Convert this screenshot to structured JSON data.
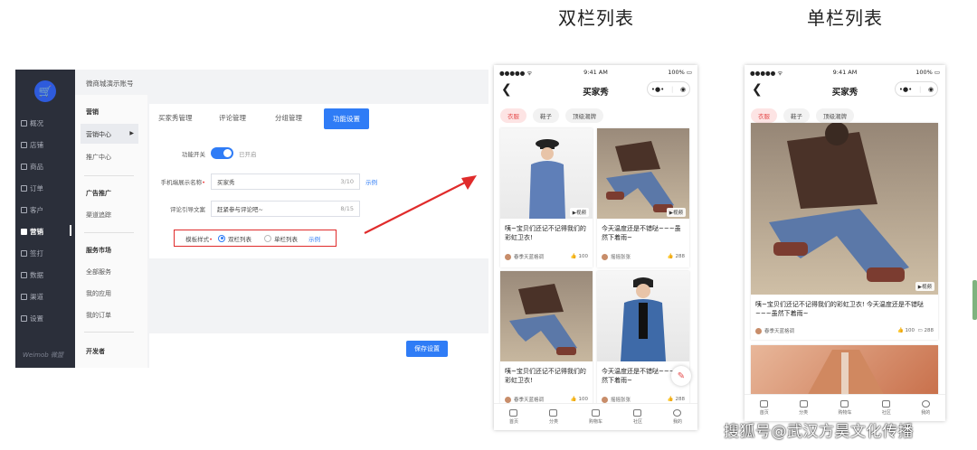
{
  "headings": {
    "double": "双栏列表",
    "single": "单栏列表"
  },
  "admin": {
    "account": "微商城演示账号",
    "brand": "Weimob 微盟",
    "nav": [
      {
        "label": "概况",
        "icon": "overview-icon"
      },
      {
        "label": "店铺",
        "icon": "store-icon"
      },
      {
        "label": "商品",
        "icon": "goods-icon"
      },
      {
        "label": "订单",
        "icon": "order-icon"
      },
      {
        "label": "客户",
        "icon": "customer-icon"
      },
      {
        "label": "营销",
        "icon": "marketing-icon"
      },
      {
        "label": "签打",
        "icon": "sign-icon"
      },
      {
        "label": "数据",
        "icon": "data-icon"
      },
      {
        "label": "渠道",
        "icon": "channel-icon"
      },
      {
        "label": "设置",
        "icon": "settings-icon"
      }
    ],
    "subnav": {
      "group1": "营销",
      "marketing_center": "营销中心",
      "promo_center": "推广中心",
      "group2": "广告推广",
      "ad_track": "渠道追踪",
      "group3": "服务市场",
      "all_services": "全部服务",
      "my_apps": "我的应用",
      "my_orders": "我的订单",
      "group4": "开发者"
    },
    "tabs": [
      "买家秀管理",
      "评论管理",
      "分组管理",
      "功能设置"
    ],
    "form": {
      "switch_label": "功能开关",
      "switch_state": "已开启",
      "name_label": "手机端展示名称",
      "name_value": "买家秀",
      "name_count": "3/10",
      "example": "示例",
      "guide_label": "评论引导文案",
      "guide_value": "赶紧参与评论吧~",
      "guide_count": "8/15",
      "template_label": "模板样式",
      "template_options": [
        "双栏列表",
        "单栏列表"
      ],
      "template_selected": "双栏列表"
    },
    "save": "保存设置"
  },
  "phone": {
    "carrier": "●●●●● ᯤ",
    "time": "9:41 AM",
    "battery": "100% ▭",
    "title": "买家秀",
    "back": "❮",
    "capsule_more": "•●•",
    "capsule_close": "◉",
    "chips": [
      "衣服",
      "鞋子",
      "顶级潮牌"
    ],
    "video_tag": "▶视频",
    "tabbar": [
      "首页",
      "分类",
      "购物车",
      "社区",
      "我的"
    ]
  },
  "double_cards": [
    {
      "text": "咦~宝贝们还记不记得我们的彩虹卫衣!",
      "user": "春季天蓝格调",
      "likes": "100"
    },
    {
      "text": "今天温度还是不错哒~~~虽然下着雨~",
      "user": "摇摇张张",
      "likes": "288"
    },
    {
      "text": "咦~宝贝们还记不记得我们的彩虹卫衣!",
      "user": "春季天蓝格调",
      "likes": "100"
    },
    {
      "text": "今天温度还是不错哒~~~虽然下着雨~",
      "user": "摇摇张张",
      "likes": "288"
    }
  ],
  "single_card": {
    "text": "咦~宝贝们还记不记得我们的彩虹卫衣! 今天温度还是不错哒~~~虽然下着雨~",
    "user": "春季天蓝格调",
    "likes": "100",
    "comments": "288"
  },
  "watermark": "搜狐号@武汉方昊文化传播",
  "colors": {
    "accent": "#2f7cf6",
    "nav_bg": "#2b2f3a",
    "highlight_red": "#e02b2b",
    "chip_red": "#e54b4b"
  }
}
